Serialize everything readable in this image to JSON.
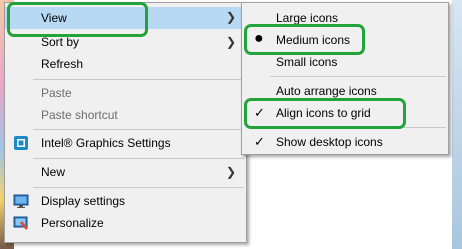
{
  "main_menu": {
    "view": "View",
    "sort_by": "Sort by",
    "refresh": "Refresh",
    "paste": "Paste",
    "paste_shortcut": "Paste shortcut",
    "intel_graphics": "Intel® Graphics Settings",
    "new": "New",
    "display_settings": "Display settings",
    "personalize": "Personalize"
  },
  "view_submenu": {
    "large_icons": "Large icons",
    "medium_icons": "Medium icons",
    "small_icons": "Small icons",
    "auto_arrange": "Auto arrange icons",
    "align_to_grid": "Align icons to grid",
    "show_desktop_icons": "Show desktop icons",
    "selected_size": "medium_icons",
    "checked": [
      "align_to_grid",
      "show_desktop_icons"
    ]
  },
  "icons": [
    "intel-graphics-icon",
    "display-settings-icon",
    "personalize-icon",
    "chevron-right-icon",
    "bullet-icon",
    "checkmark-icon"
  ],
  "colors": {
    "highlight_outline": "#23a33a",
    "hover": "#91c9f7",
    "menu_bg": "#f0f0f0"
  }
}
